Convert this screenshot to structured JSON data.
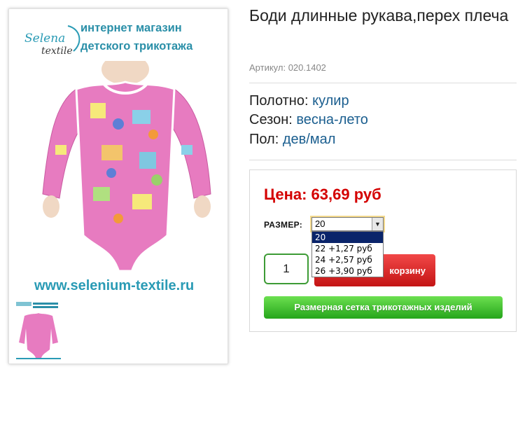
{
  "gallery": {
    "logo": {
      "brand": "Selena",
      "sub": "textile"
    },
    "shop_line1": "интернет магазин",
    "shop_line2": "детского трикотажа",
    "site_url": "www.selenium-textile.ru"
  },
  "product": {
    "title": "Боди длинные рукава,перех плеча",
    "sku": "Артикул: 020.1402",
    "attributes": [
      {
        "label": "Полотно:",
        "value": "кулир"
      },
      {
        "label": "Сезон:",
        "value": "весна-лето"
      },
      {
        "label": "Пол:",
        "value": "дев/мал"
      }
    ]
  },
  "buy_box": {
    "price": "Цена: 63,69 руб",
    "size_label": "РАЗМЕР:",
    "size_selected": "20",
    "size_options": [
      "20",
      "22 +1,27 руб",
      "24 +2,57 руб",
      "26 +3,90 руб"
    ],
    "quantity": "1",
    "cart_button_label": "корзину",
    "size_chart_button_label": "Размерная сетка трикотажных изделий"
  },
  "colors": {
    "price": "#d40000",
    "attribute_value": "#1a5e8f",
    "cart_button": "#e02a2a",
    "size_chart_button": "#3cbf2e",
    "brand_teal": "#2a9bb5",
    "garment_pink": "#e77bc0"
  }
}
